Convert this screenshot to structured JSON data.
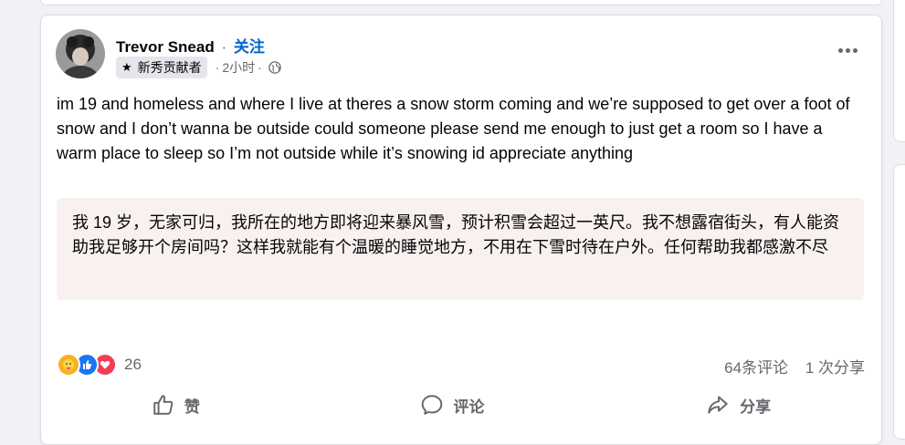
{
  "post": {
    "author": "Trevor Snead",
    "separator": "·",
    "follow_label": "关注",
    "badge_label": "新秀贡献者",
    "time": "2小时",
    "more_icon": "more-horizontal-icon",
    "body": "im 19 and homeless and where I live at theres a snow storm coming and we’re supposed to get over a foot of snow and I don’t wanna be outside could someone please send me enough to just get a room so I have a warm place to sleep so I’m not outside while it’s snowing id appreciate anything",
    "translation": "我 19 岁，无家可归，我所在的地方即将迎来暴风雪，预计积雪会超过一英尺。我不想露宿街头，有人能资助我足够开个房间吗？这样我就能有个温暖的睡觉地方，不用在下雪时待在户外。任何帮助我都感激不尽"
  },
  "reactions": {
    "icons": [
      "care-icon",
      "like-icon",
      "love-icon"
    ],
    "count": "26"
  },
  "stats": {
    "comments": "64条评论",
    "shares": "1 次分享"
  },
  "actions": {
    "like": "赞",
    "comment": "评论",
    "share": "分享"
  },
  "colors": {
    "accent": "#0064d1",
    "translation_bg": "#f8f1f0",
    "secondary_text": "#65676b"
  }
}
